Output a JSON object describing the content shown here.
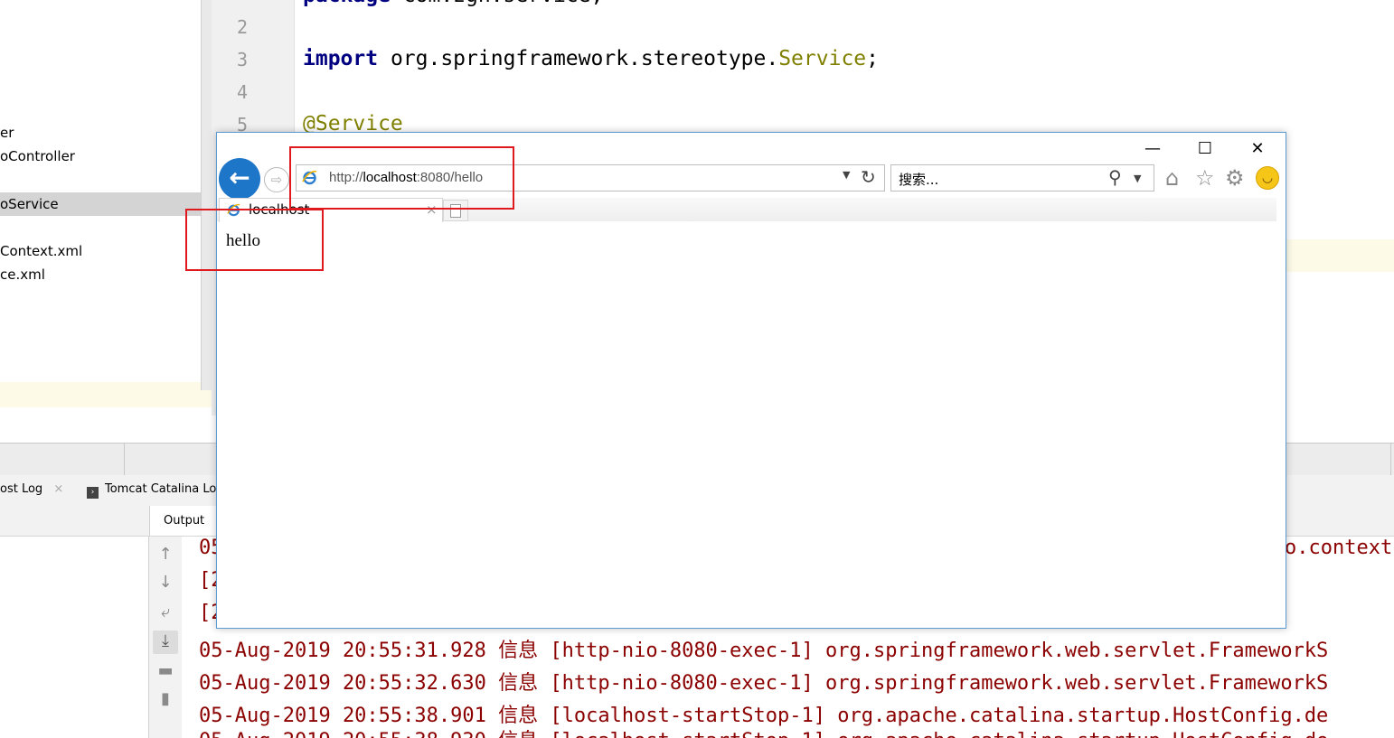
{
  "project_tree": {
    "items": [
      {
        "label": "er"
      },
      {
        "label": "oController"
      },
      {
        "label": "oService"
      },
      {
        "label": "Context.xml"
      },
      {
        "label": "ce.xml"
      }
    ]
  },
  "editor": {
    "line_numbers": [
      "2",
      "3",
      "4",
      "5"
    ],
    "line1": {
      "kw": "package",
      "rest": " com.zgh.service;"
    },
    "line3": {
      "kw": "import",
      "pkg": " org.springframework.stereotype.",
      "cls": "Service",
      "end": ";"
    },
    "line5": {
      "anno": "@Service"
    }
  },
  "tool_window": {
    "tabs": [
      {
        "label": "ost Log",
        "close": "×"
      },
      {
        "label": "Tomcat Catalina Log"
      }
    ],
    "output_label": "Output"
  },
  "console": {
    "lines": [
      "05",
      "[2",
      "[2",
      "05-Aug-2019 20:55:31.928 信息 [http-nio-8080-exec-1] org.springframework.web.servlet.FrameworkS",
      "05-Aug-2019 20:55:32.630 信息 [http-nio-8080-exec-1] org.springframework.web.servlet.FrameworkS",
      "05-Aug-2019 20:55:38.901 信息 [localhost-startStop-1] org.apache.catalina.startup.HostConfig.de",
      "05-Aug-2019 20:55:38.930 信息 [localhost-startStop-1] org.apache.catalina.startup.HostConfig.de"
    ],
    "right_fragment": "o.context"
  },
  "browser": {
    "window_controls": {
      "minimize": "—",
      "maximize": "☐",
      "close": "✕"
    },
    "address": {
      "scheme": "http://",
      "host": "localhost",
      "rest": ":8080/hello"
    },
    "search_placeholder": "搜索...",
    "tab": {
      "title": "localhost",
      "close": "×"
    },
    "page_content": "hello"
  },
  "colors": {
    "annotation_red": "#e0191f",
    "console_text": "#8b0000",
    "keyword": "#000080",
    "annotation_olive": "#808000",
    "ie_back_blue": "#1e76c8"
  }
}
